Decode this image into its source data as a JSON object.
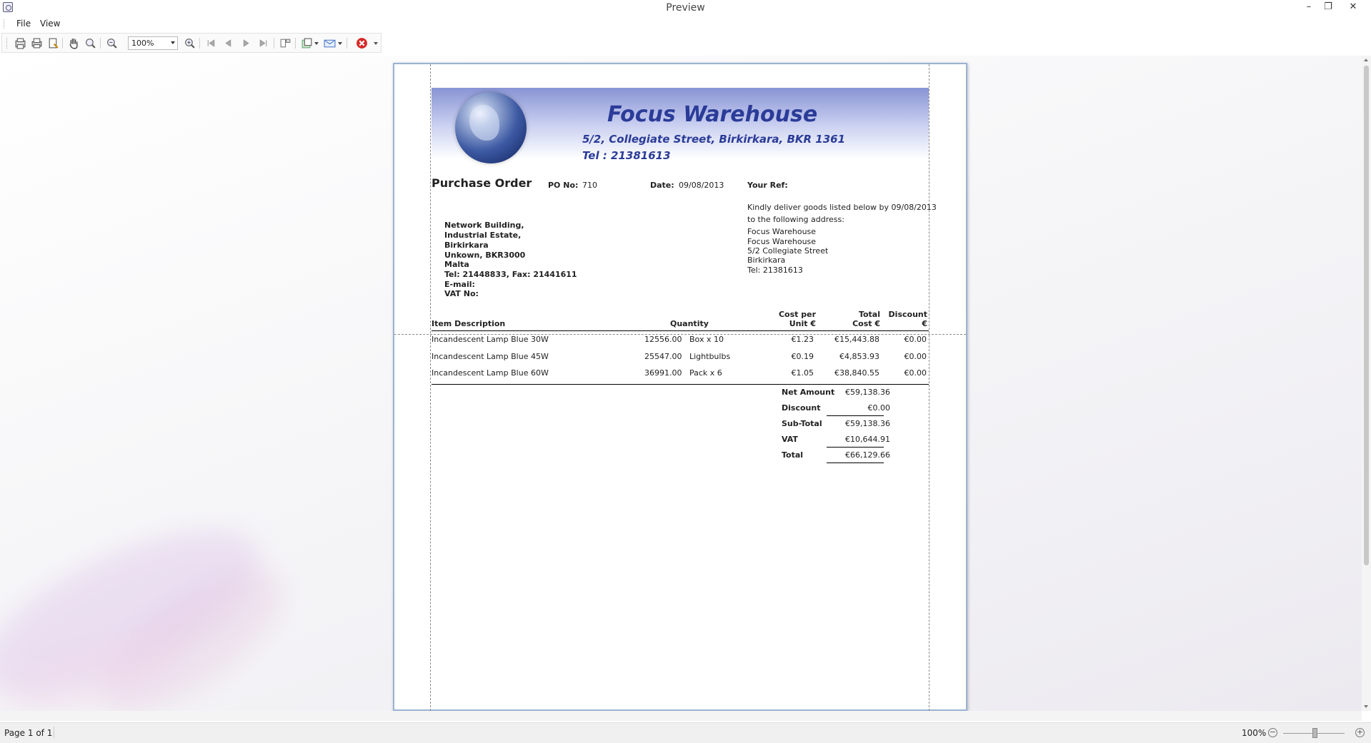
{
  "window": {
    "title": "Preview"
  },
  "menu": {
    "file": "File",
    "view": "View"
  },
  "toolbar": {
    "zoom_value": "100%"
  },
  "status": {
    "page_indicator": "Page 1 of 1",
    "zoom": "100%"
  },
  "report": {
    "company": {
      "name": "Focus Warehouse",
      "address": "5/2, Collegiate Street, Birkirkara, BKR 1361",
      "tel": "Tel : 21381613"
    },
    "title": "Purchase Order",
    "po_label": "PO No:",
    "po_value": "710",
    "date_label": "Date:",
    "date_value": "09/08/2013",
    "your_ref_label": "Your Ref:",
    "supplier_address": [
      "Network Building,",
      "Industrial Estate,",
      "Birkirkara",
      "Unkown,  BKR3000",
      "Malta",
      "Tel: 21448833,  Fax: 21441611",
      "E-mail:",
      "VAT No:"
    ],
    "delivery": [
      "Kindly deliver goods listed below by  09/08/2013",
      "to the following address:",
      "Focus Warehouse",
      "Focus Warehouse",
      "5/2 Collegiate Street",
      "Birkirkara",
      "Tel: 21381613"
    ],
    "columns": {
      "item": "Item Description",
      "qty": "Quantity",
      "cpu_1": "Cost per",
      "cpu_2": "Unit €",
      "total_1": "Total",
      "total_2": "Cost €",
      "disc_1": "Discount",
      "disc_2": "€"
    },
    "items": [
      {
        "desc": "Incandescent Lamp Blue 30W",
        "qty": "12556.00",
        "unit": "Box x 10",
        "cpu": "€1.23",
        "total": "€15,443.88",
        "disc": "€0.00"
      },
      {
        "desc": "Incandescent Lamp Blue 45W",
        "qty": "25547.00",
        "unit": "Lightbulbs",
        "cpu": "€0.19",
        "total": "€4,853.93",
        "disc": "€0.00"
      },
      {
        "desc": "Incandescent Lamp Blue 60W",
        "qty": "36991.00",
        "unit": "Pack x 6",
        "cpu": "€1.05",
        "total": "€38,840.55",
        "disc": "€0.00"
      }
    ],
    "totals": {
      "net_label": "Net Amount",
      "net": "€59,138.36",
      "discount_label": "Discount",
      "discount": "€0.00",
      "subtotal_label": "Sub-Total",
      "subtotal": "€59,138.36",
      "vat_label": "VAT",
      "vat": "€10,644.91",
      "total_label": "Total",
      "total": "€66,129.66"
    }
  }
}
